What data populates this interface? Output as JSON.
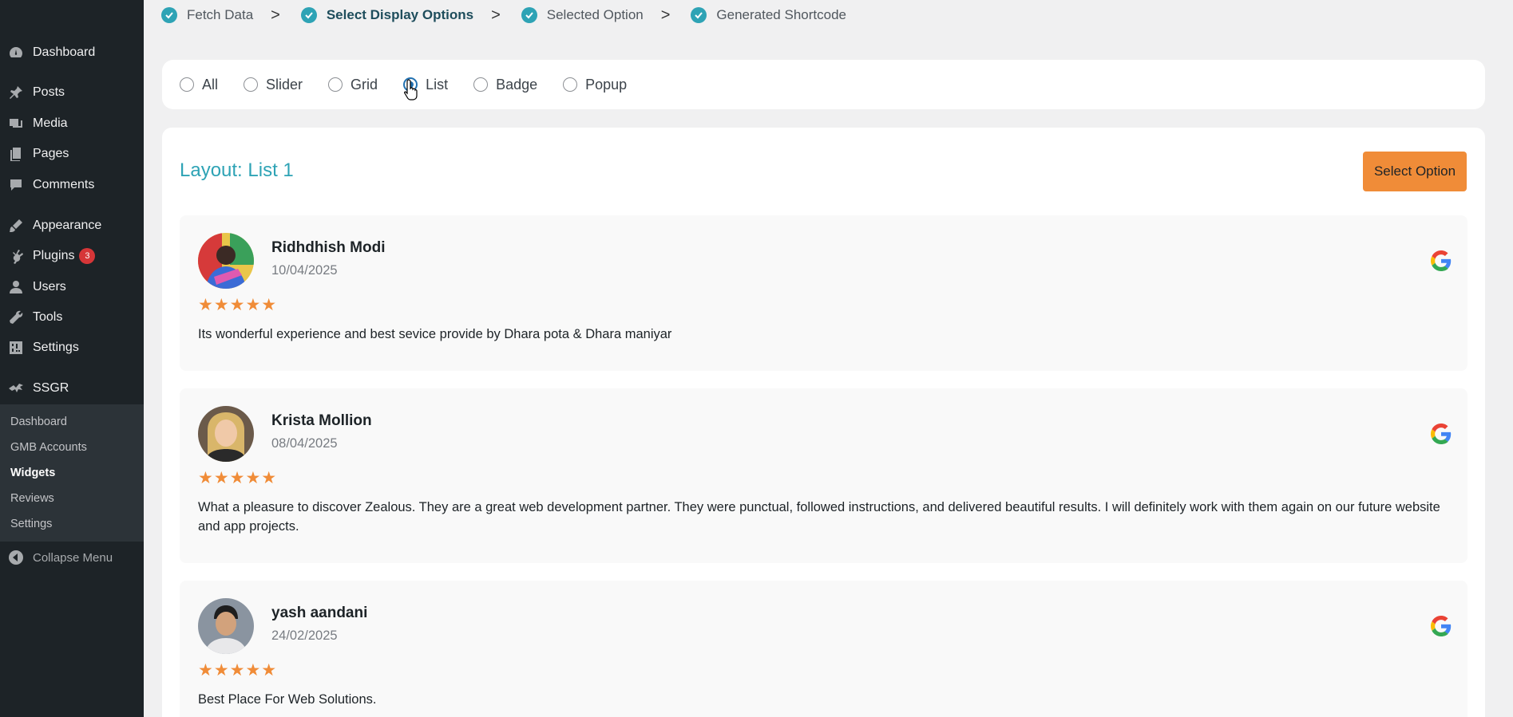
{
  "sidebar": {
    "items": [
      {
        "label": "Dashboard",
        "icon": "dashboard-icon"
      },
      {
        "label": "Posts",
        "icon": "pin-icon"
      },
      {
        "label": "Media",
        "icon": "media-icon"
      },
      {
        "label": "Pages",
        "icon": "pages-icon"
      },
      {
        "label": "Comments",
        "icon": "comments-icon"
      },
      {
        "label": "Appearance",
        "icon": "brush-icon"
      },
      {
        "label": "Plugins",
        "icon": "plugin-icon",
        "badge": "3"
      },
      {
        "label": "Users",
        "icon": "users-icon"
      },
      {
        "label": "Tools",
        "icon": "wrench-icon"
      },
      {
        "label": "Settings",
        "icon": "settings-icon"
      },
      {
        "label": "SSGR",
        "icon": "ssgr-icon"
      }
    ],
    "submenu": [
      "Dashboard",
      "GMB Accounts",
      "Widgets",
      "Reviews",
      "Settings"
    ],
    "active_sub": "Widgets",
    "collapse": "Collapse Menu"
  },
  "steps": [
    "Fetch Data",
    "Select Display Options",
    "Selected Option",
    "Generated Shortcode"
  ],
  "options": [
    "All",
    "Slider",
    "Grid",
    "List",
    "Badge",
    "Popup"
  ],
  "selected_option": "List",
  "panel": {
    "title": "Layout: List 1",
    "button": "Select Option"
  },
  "reviews": [
    {
      "name": "Ridhdhish Modi",
      "date": "10/04/2025",
      "stars": "★★★★★",
      "text": "Its wonderful experience and best sevice provide by Dhara pota & Dhara maniyar"
    },
    {
      "name": "Krista Mollion",
      "date": "08/04/2025",
      "stars": "★★★★★",
      "text": "What a pleasure to discover Zealous. They are a great web development partner. They were punctual, followed instructions, and delivered beautiful results. I will definitely work with them again on our future website and app projects."
    },
    {
      "name": "yash aandani",
      "date": "24/02/2025",
      "stars": "★★★★★",
      "text": "Best Place For Web Solutions."
    }
  ],
  "colors": {
    "accent": "#2ea3b5",
    "button": "#f08c38",
    "sidebar": "#1d2327",
    "radio": "#2271b1"
  }
}
